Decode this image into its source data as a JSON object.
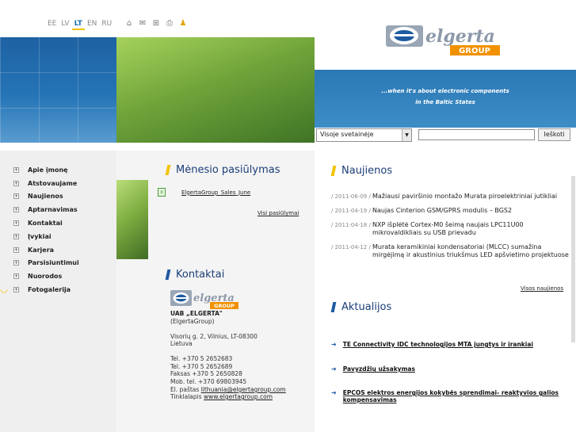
{
  "languages": [
    {
      "label": "EE",
      "active": false
    },
    {
      "label": "LV",
      "active": false
    },
    {
      "label": "LT",
      "active": true
    },
    {
      "label": "EN",
      "active": false
    },
    {
      "label": "RU",
      "active": false
    }
  ],
  "tools": [
    {
      "icon": "home-icon",
      "glyph": "⌂"
    },
    {
      "icon": "mail-icon",
      "glyph": "✉"
    },
    {
      "icon": "sitemap-icon",
      "glyph": "⊞"
    },
    {
      "icon": "print-icon",
      "glyph": "⎙"
    },
    {
      "icon": "group-icon",
      "glyph": "♟"
    }
  ],
  "brand": {
    "name": "elgerta",
    "group": "GROUP",
    "color_blue": "#1d5aa0",
    "color_orange": "#f29100"
  },
  "tagline": {
    "line1": "...when it's about electronic components",
    "line2": "in the Baltic States"
  },
  "search": {
    "scope": "Visoje svetainėje",
    "button": "Ieškoti"
  },
  "nav": [
    "Apie įmonę",
    "Atstovaujame",
    "Naujienos",
    "Aptarnavimas",
    "Kontaktai",
    "Įvykiai",
    "Karjera",
    "Parsisiuntimui",
    "Nuorodos",
    "Fotogalerija"
  ],
  "offers": {
    "title": "Mėnesio pasiūlymas",
    "file": "ElgertaGroup_Sales_June",
    "all_link": "Visi pasiūlymai"
  },
  "contacts": {
    "title": "Kontaktai",
    "company": "UAB „ELGERTA\"",
    "group": "(ElgertaGroup)",
    "address1": "Visorių g. 2, Vilnius, LT-08300",
    "address2": "Lietuva",
    "tel1": "Tel.  +370 5 2652683",
    "tel2": "Tel.  +370 5 2652689",
    "fax": "Faksas +370 5 2650828",
    "mob": "Mob. tel. +370 69803945",
    "email_label": "El. paštas",
    "email": "lithuania@elgertagroup.com",
    "web_label": "Tinklalapis",
    "web": "www.elgertagroup.com"
  },
  "news": {
    "title": "Naujienos",
    "items": [
      {
        "date": "/ 2011-06-09 /",
        "text": "Mažiausi paviršinio montažo Murata piroelektriniai jutikliai"
      },
      {
        "date": "/ 2011-04-19 /",
        "text": "Naujas Cinterion GSM/GPRS modulis – BGS2"
      },
      {
        "date": "/ 2011-04-18 /",
        "text": "NXP išplėtė Cortex-M0 šeimą naujais LPC11U00 mikrovaldikliais su USB prievadu"
      },
      {
        "date": "/ 2011-04-12 /",
        "text": "Murata keramikiniai kondensatoriai (MLCC) sumažina mirgėjimą ir akustinius triukšmus LED apšvietimo projektuose"
      }
    ],
    "all_link": "Visos naujienos"
  },
  "highlights": {
    "title": "Aktualijos",
    "items": [
      "TE Connectivity IDC technologijos MTA jungtys  ir įrankiai",
      "Pavyzdžių užsakymas",
      "EPCOS elektros energijos kokybės sprendimai- reaktyvios galios kompensavimas"
    ]
  },
  "colors": {
    "title_blue": "#1b3e78",
    "bar_yellow": "#f2c300",
    "bar_blue": "#1d5aa0"
  }
}
